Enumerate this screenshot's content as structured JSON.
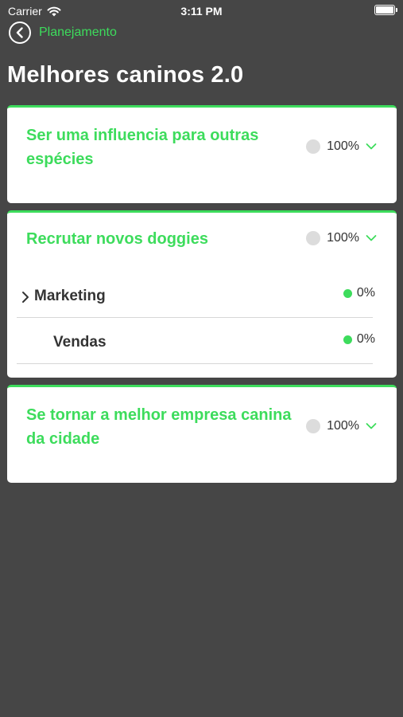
{
  "status_bar": {
    "carrier": "Carrier",
    "time": "3:11 PM"
  },
  "nav": {
    "back_label": "Planejamento"
  },
  "page": {
    "title": "Melhores caninos 2.0"
  },
  "cards": [
    {
      "title": "Ser uma influencia para outras espécies",
      "percent": "100%",
      "subitems": []
    },
    {
      "title": "Recrutar novos doggies",
      "percent": "100%",
      "subitems": [
        {
          "label": "Marketing",
          "percent": "0%",
          "expandable": true
        },
        {
          "label": "Vendas",
          "percent": "0%",
          "expandable": false
        }
      ]
    },
    {
      "title": "Se tornar a melhor empresa canina da cidade",
      "percent": "100%",
      "subitems": []
    }
  ],
  "colors": {
    "accent": "#3ddc5c",
    "background": "#464646",
    "card": "#ffffff",
    "text": "#333333"
  }
}
